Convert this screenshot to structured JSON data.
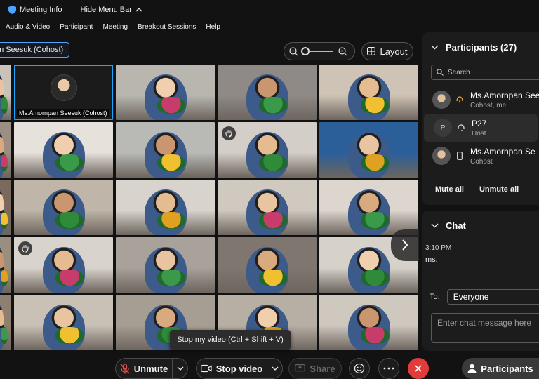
{
  "topbar": {
    "meeting_info": "Meeting Info",
    "hide_menu_bar": "Hide Menu Bar"
  },
  "menubar": {
    "items": [
      "Audio & Video",
      "Participant",
      "Meeting",
      "Breakout Sessions",
      "Help"
    ]
  },
  "stage": {
    "cohost_chip": "an Seesuk (Cohost)",
    "layout_label": "Layout",
    "active_tile_label": "Ms.Amornpan Seesuk  (Cohost)"
  },
  "tooltip": "Stop my video (Ctrl + Shift + V)",
  "toolbar": {
    "unmute": "Unmute",
    "stop_video": "Stop video",
    "share": "Share",
    "participants": "Participants"
  },
  "participants_panel": {
    "title": "Participants (27)",
    "search_placeholder": "Search",
    "people": [
      {
        "name": "Ms.Amornpan Seesuk",
        "role": "Cohost, me",
        "initial": ""
      },
      {
        "name": "P27",
        "role": "Host",
        "initial": "P"
      },
      {
        "name": "Ms.Amornpan Se",
        "role": "Cohost",
        "initial": ""
      }
    ],
    "mute_all": "Mute all",
    "unmute_all": "Unmute all"
  },
  "chat_panel": {
    "title": "Chat",
    "time": "3:10 PM",
    "message": "ms.",
    "to_label": "To:",
    "to_value": "Everyone",
    "input_placeholder": "Enter chat message here"
  },
  "colors": {
    "accent_blue": "#1aa3ff",
    "end_red": "#e03c3c",
    "background": "#121212",
    "panel": "#1c1c1c"
  }
}
